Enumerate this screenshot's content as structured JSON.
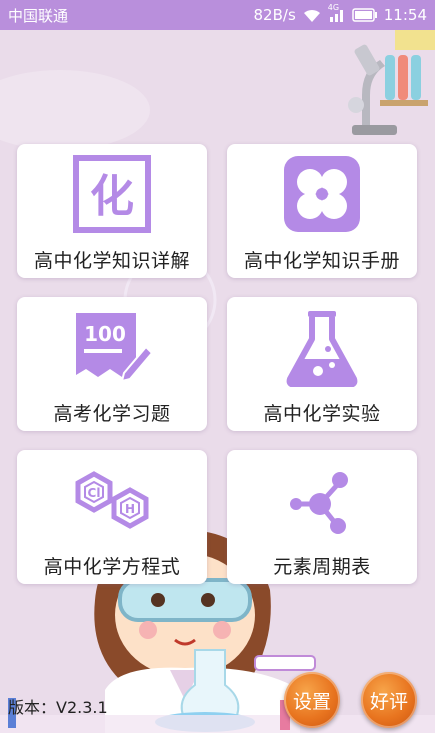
{
  "status_bar": {
    "carrier": "中国联通",
    "speed": "82B/s",
    "network": "4G",
    "time": "11:54"
  },
  "cards": [
    {
      "label": "高中化学知识详解",
      "icon": "hua-character-icon"
    },
    {
      "label": "高中化学知识手册",
      "icon": "petals-icon"
    },
    {
      "label": "高考化学习题",
      "icon": "score-paper-icon",
      "icon_text": "100"
    },
    {
      "label": "高中化学实验",
      "icon": "flask-icon"
    },
    {
      "label": "高中化学方程式",
      "icon": "hexagon-molecule-icon",
      "icon_text_1": "Cl",
      "icon_text_2": "H"
    },
    {
      "label": "元素周期表",
      "icon": "molecule-node-icon"
    }
  ],
  "footer": {
    "version": "版本：V2.3.1",
    "settings_label": "设置",
    "rate_label": "好评"
  },
  "colors": {
    "status_bar": "#b98fdc",
    "icon_purple": "#b48ae6",
    "background": "#eadcea",
    "button_orange": "#e8741f"
  }
}
